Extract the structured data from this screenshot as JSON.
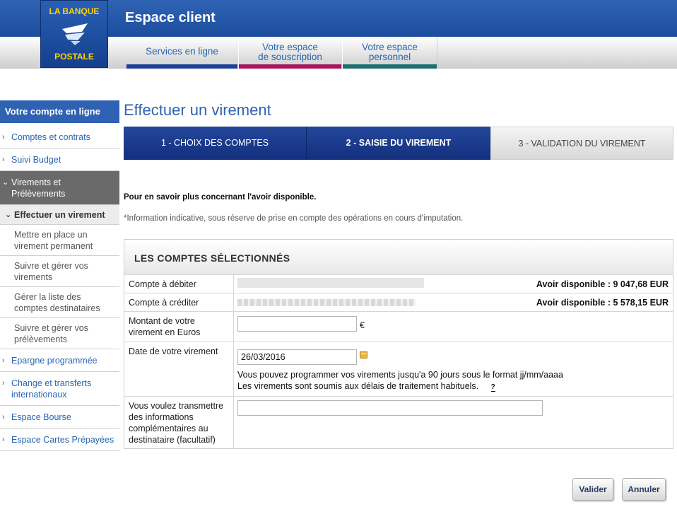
{
  "header": {
    "title": "Espace client",
    "logo_top": "LA BANQUE",
    "logo_bottom": "POSTALE",
    "nav": [
      {
        "label": "Services en ligne",
        "color": "#1f3f99"
      },
      {
        "label": "Votre espace\nde souscription",
        "color": "#a5175d"
      },
      {
        "label": "Votre espace\npersonnel",
        "color": "#1c6e73"
      }
    ]
  },
  "sidebar": {
    "title": "Votre compte en ligne",
    "items": [
      {
        "label": "Comptes et contrats"
      },
      {
        "label": "Suivi Budget"
      },
      {
        "label": "Virements et Prélèvements"
      },
      {
        "label": "Epargne programmée"
      },
      {
        "label": "Change et transferts internationaux"
      },
      {
        "label": "Espace Bourse"
      },
      {
        "label": "Espace Cartes Prépayées"
      }
    ],
    "sub_items": [
      {
        "label": "Effectuer un virement"
      },
      {
        "label": "Mettre en place un virement permanent"
      },
      {
        "label": "Suivre et gérer vos virements"
      },
      {
        "label": "Gérer la liste des comptes destinataires"
      },
      {
        "label": "Suivre et gérer vos prélèvements"
      }
    ]
  },
  "main": {
    "title": "Effectuer un virement",
    "steps": [
      {
        "label": "1 - CHOIX DES COMPTES"
      },
      {
        "label": "2 - SAISIE DU VIREMENT"
      },
      {
        "label": "3 - VALIDATION DU VIREMENT"
      }
    ],
    "info_bold": "Pour en savoir plus concernant l'avoir disponible.",
    "info_note": "*Information indicative, sous réserve de prise en compte des opérations en cours d'imputation.",
    "section_title": "LES COMPTES SÉLECTIONNÉS",
    "rows": {
      "debit_label": "Compte à débiter",
      "debit_avoir": "Avoir disponible : 9 047,68 EUR",
      "credit_label": "Compte à créditer",
      "credit_avoir": "Avoir disponible : 5 578,15 EUR",
      "amount_label": "Montant de votre virement en Euros",
      "amount_value": "",
      "currency": "€",
      "date_label": "Date de votre virement",
      "date_value": "26/03/2016",
      "date_hint_1": "Vous pouvez programmer vos virements jusqu'a 90 jours sous le format jj/mm/aaaa",
      "date_hint_2": "Les virements sont soumis aux délais de traitement habituels.",
      "help_icon_text": "?",
      "info_label": "Vous voulez transmettre des informations complémentaires au destinataire (facultatif)",
      "info_value": ""
    }
  },
  "buttons": {
    "validate": "Valider",
    "cancel": "Annuler"
  },
  "colors": {
    "brand_blue": "#2f62b2",
    "step_active": "#132f7d",
    "logo_yellow": "#ffd200"
  }
}
